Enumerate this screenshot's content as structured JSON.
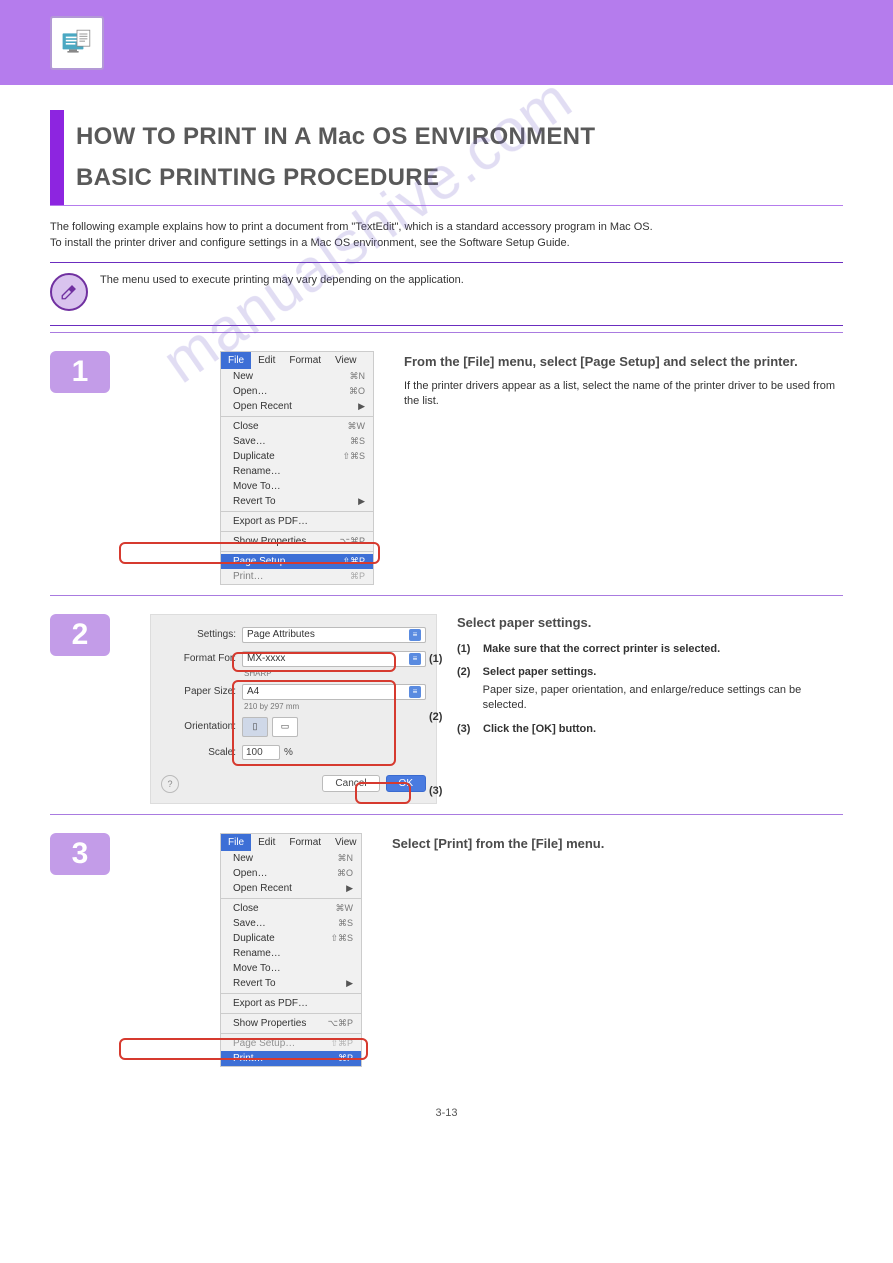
{
  "watermark": "manualshive.com",
  "header": {
    "icon_name": "printer-doc-icon"
  },
  "title": "HOW TO PRINT IN A Mac OS ENVIRONMENT",
  "subtitle": "BASIC PRINTING PROCEDURE",
  "intro": "The following example explains how to print a document from \"TextEdit\", which is a standard accessory program in Mac OS.\nTo install the printer driver and configure settings in a Mac OS environment, see the Software Setup Guide.",
  "note": "The menu used to execute printing may vary depending on the application.",
  "steps": {
    "s1": {
      "num": "1",
      "text1": "From the [File] menu, select [Page Setup] and select the printer.",
      "text2": "If the printer drivers appear as a list, select the name of the printer driver to be used from the list."
    },
    "s2": {
      "num": "2",
      "text_bold": "Select paper settings.",
      "bullets": {
        "b1": {
          "label": "(1)",
          "text": "Make sure that the correct printer is selected."
        },
        "b2": {
          "label": "(2)",
          "text": "Select paper settings.",
          "sub": "Paper size, paper orientation, and enlarge/reduce settings can be selected."
        },
        "b3": {
          "label": "(3)",
          "text": "Click the [OK] button."
        }
      },
      "side_labels": {
        "l1": "(1)",
        "l2": "(2)",
        "l3": "(3)"
      }
    },
    "s3": {
      "num": "3",
      "text_bold": "Select [Print] from the [File] menu."
    }
  },
  "menu": {
    "bar": [
      "File",
      "Edit",
      "Format",
      "View"
    ],
    "items": {
      "new": "New",
      "new_sc": "⌘N",
      "open": "Open…",
      "open_sc": "⌘O",
      "recent": "Open Recent",
      "close": "Close",
      "close_sc": "⌘W",
      "save": "Save…",
      "save_sc": "⌘S",
      "dup": "Duplicate",
      "dup_sc": "⇧⌘S",
      "rename": "Rename…",
      "moveto": "Move To…",
      "revert": "Revert To",
      "export": "Export as PDF…",
      "props": "Show Properties",
      "props_sc": "⌥⌘P",
      "setup": "Page Setup…",
      "setup_sc": "⇧⌘P",
      "print": "Print…",
      "print_sc": "⌘P"
    }
  },
  "dialog": {
    "settings_l": "Settings:",
    "settings_v": "Page Attributes",
    "format_l": "Format For:",
    "format_v": "MX-xxxx",
    "format_sub": "SHARP",
    "paper_l": "Paper Size:",
    "paper_v": "A4",
    "paper_sub": "210 by 297 mm",
    "orient_l": "Orientation:",
    "scale_l": "Scale:",
    "scale_v": "100",
    "scale_pct": "%",
    "cancel": "Cancel",
    "ok": "OK",
    "help": "?"
  },
  "page_number": "3-13"
}
